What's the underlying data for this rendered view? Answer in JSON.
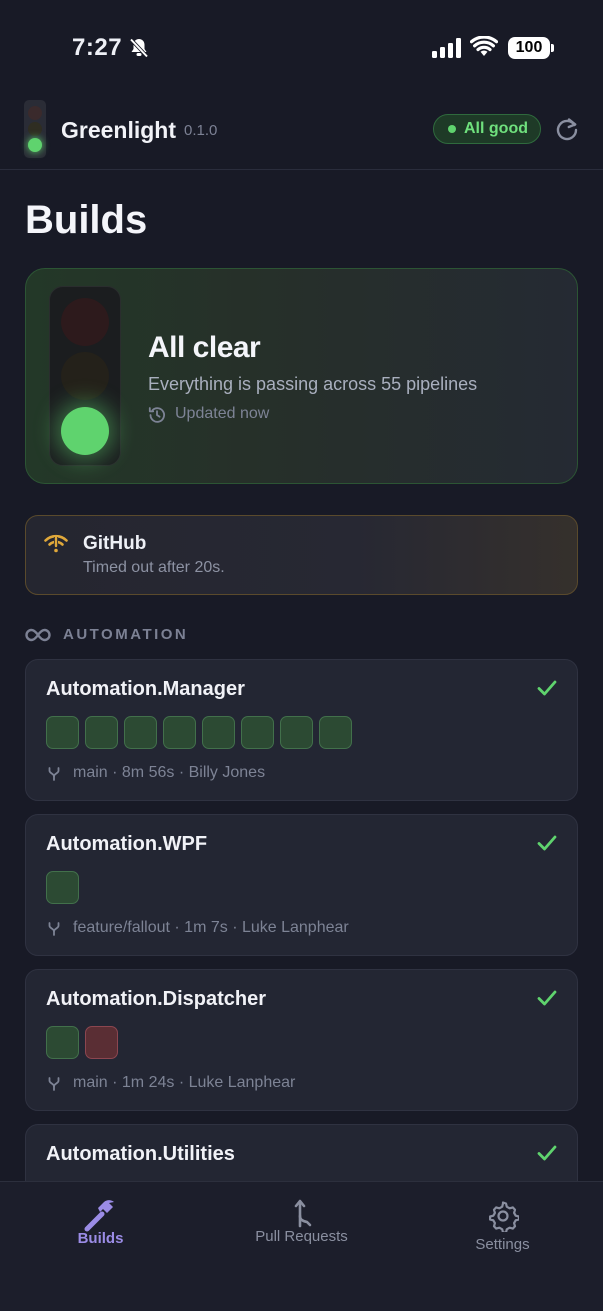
{
  "status_bar": {
    "time": "7:27",
    "battery": "100"
  },
  "app": {
    "name": "Greenlight",
    "version": "0.1.0",
    "status_label": "All good"
  },
  "page": {
    "title": "Builds"
  },
  "hero": {
    "title": "All clear",
    "subtitle": "Everything is passing across 55 pipelines",
    "updated": "Updated now"
  },
  "alert": {
    "title": "GitHub",
    "message": "Timed out after 20s."
  },
  "section": {
    "label": "AUTOMATION"
  },
  "pipelines": [
    {
      "name": "Automation.Manager",
      "jobs": [
        "pass",
        "pass",
        "pass",
        "pass",
        "pass",
        "pass",
        "pass",
        "pass"
      ],
      "meta": "main  ·  8m 56s  ·  Billy Jones"
    },
    {
      "name": "Automation.WPF",
      "jobs": [
        "pass"
      ],
      "meta": "feature/fallout  ·  1m 7s  ·  Luke Lanphear"
    },
    {
      "name": "Automation.Dispatcher",
      "jobs": [
        "pass",
        "fail"
      ],
      "meta": "main  ·  1m 24s  ·  Luke Lanphear"
    },
    {
      "name": "Automation.Utilities",
      "jobs": [],
      "meta": ""
    }
  ],
  "tabs": [
    {
      "label": "Builds",
      "icon": "hammer-icon",
      "active": true
    },
    {
      "label": "Pull Requests",
      "icon": "pull-request-icon",
      "active": false
    },
    {
      "label": "Settings",
      "icon": "gear-icon",
      "active": false
    }
  ],
  "colors": {
    "background": "#181a26",
    "success": "#5fd36e",
    "warning": "#e0a83a",
    "accent": "#9b8ce6"
  }
}
